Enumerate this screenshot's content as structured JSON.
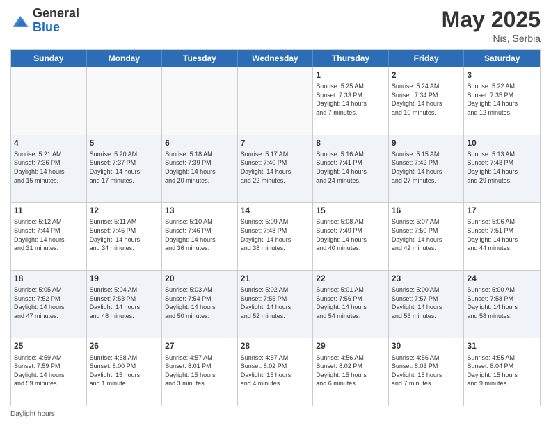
{
  "header": {
    "logo_general": "General",
    "logo_blue": "Blue",
    "title": "May 2025",
    "location": "Nis, Serbia"
  },
  "days_of_week": [
    "Sunday",
    "Monday",
    "Tuesday",
    "Wednesday",
    "Thursday",
    "Friday",
    "Saturday"
  ],
  "weeks": [
    [
      {
        "day": "",
        "info": "",
        "empty": true
      },
      {
        "day": "",
        "info": "",
        "empty": true
      },
      {
        "day": "",
        "info": "",
        "empty": true
      },
      {
        "day": "",
        "info": "",
        "empty": true
      },
      {
        "day": "1",
        "info": "Sunrise: 5:25 AM\nSunset: 7:33 PM\nDaylight: 14 hours\nand 7 minutes."
      },
      {
        "day": "2",
        "info": "Sunrise: 5:24 AM\nSunset: 7:34 PM\nDaylight: 14 hours\nand 10 minutes."
      },
      {
        "day": "3",
        "info": "Sunrise: 5:22 AM\nSunset: 7:35 PM\nDaylight: 14 hours\nand 12 minutes."
      }
    ],
    [
      {
        "day": "4",
        "info": "Sunrise: 5:21 AM\nSunset: 7:36 PM\nDaylight: 14 hours\nand 15 minutes."
      },
      {
        "day": "5",
        "info": "Sunrise: 5:20 AM\nSunset: 7:37 PM\nDaylight: 14 hours\nand 17 minutes."
      },
      {
        "day": "6",
        "info": "Sunrise: 5:18 AM\nSunset: 7:39 PM\nDaylight: 14 hours\nand 20 minutes."
      },
      {
        "day": "7",
        "info": "Sunrise: 5:17 AM\nSunset: 7:40 PM\nDaylight: 14 hours\nand 22 minutes."
      },
      {
        "day": "8",
        "info": "Sunrise: 5:16 AM\nSunset: 7:41 PM\nDaylight: 14 hours\nand 24 minutes."
      },
      {
        "day": "9",
        "info": "Sunrise: 5:15 AM\nSunset: 7:42 PM\nDaylight: 14 hours\nand 27 minutes."
      },
      {
        "day": "10",
        "info": "Sunrise: 5:13 AM\nSunset: 7:43 PM\nDaylight: 14 hours\nand 29 minutes."
      }
    ],
    [
      {
        "day": "11",
        "info": "Sunrise: 5:12 AM\nSunset: 7:44 PM\nDaylight: 14 hours\nand 31 minutes."
      },
      {
        "day": "12",
        "info": "Sunrise: 5:11 AM\nSunset: 7:45 PM\nDaylight: 14 hours\nand 34 minutes."
      },
      {
        "day": "13",
        "info": "Sunrise: 5:10 AM\nSunset: 7:46 PM\nDaylight: 14 hours\nand 36 minutes."
      },
      {
        "day": "14",
        "info": "Sunrise: 5:09 AM\nSunset: 7:48 PM\nDaylight: 14 hours\nand 38 minutes."
      },
      {
        "day": "15",
        "info": "Sunrise: 5:08 AM\nSunset: 7:49 PM\nDaylight: 14 hours\nand 40 minutes."
      },
      {
        "day": "16",
        "info": "Sunrise: 5:07 AM\nSunset: 7:50 PM\nDaylight: 14 hours\nand 42 minutes."
      },
      {
        "day": "17",
        "info": "Sunrise: 5:06 AM\nSunset: 7:51 PM\nDaylight: 14 hours\nand 44 minutes."
      }
    ],
    [
      {
        "day": "18",
        "info": "Sunrise: 5:05 AM\nSunset: 7:52 PM\nDaylight: 14 hours\nand 47 minutes."
      },
      {
        "day": "19",
        "info": "Sunrise: 5:04 AM\nSunset: 7:53 PM\nDaylight: 14 hours\nand 48 minutes."
      },
      {
        "day": "20",
        "info": "Sunrise: 5:03 AM\nSunset: 7:54 PM\nDaylight: 14 hours\nand 50 minutes."
      },
      {
        "day": "21",
        "info": "Sunrise: 5:02 AM\nSunset: 7:55 PM\nDaylight: 14 hours\nand 52 minutes."
      },
      {
        "day": "22",
        "info": "Sunrise: 5:01 AM\nSunset: 7:56 PM\nDaylight: 14 hours\nand 54 minutes."
      },
      {
        "day": "23",
        "info": "Sunrise: 5:00 AM\nSunset: 7:57 PM\nDaylight: 14 hours\nand 56 minutes."
      },
      {
        "day": "24",
        "info": "Sunrise: 5:00 AM\nSunset: 7:58 PM\nDaylight: 14 hours\nand 58 minutes."
      }
    ],
    [
      {
        "day": "25",
        "info": "Sunrise: 4:59 AM\nSunset: 7:59 PM\nDaylight: 14 hours\nand 59 minutes."
      },
      {
        "day": "26",
        "info": "Sunrise: 4:58 AM\nSunset: 8:00 PM\nDaylight: 15 hours\nand 1 minute."
      },
      {
        "day": "27",
        "info": "Sunrise: 4:57 AM\nSunset: 8:01 PM\nDaylight: 15 hours\nand 3 minutes."
      },
      {
        "day": "28",
        "info": "Sunrise: 4:57 AM\nSunset: 8:02 PM\nDaylight: 15 hours\nand 4 minutes."
      },
      {
        "day": "29",
        "info": "Sunrise: 4:56 AM\nSunset: 8:02 PM\nDaylight: 15 hours\nand 6 minutes."
      },
      {
        "day": "30",
        "info": "Sunrise: 4:56 AM\nSunset: 8:03 PM\nDaylight: 15 hours\nand 7 minutes."
      },
      {
        "day": "31",
        "info": "Sunrise: 4:55 AM\nSunset: 8:04 PM\nDaylight: 15 hours\nand 9 minutes."
      }
    ]
  ],
  "footer": {
    "daylight_label": "Daylight hours"
  }
}
